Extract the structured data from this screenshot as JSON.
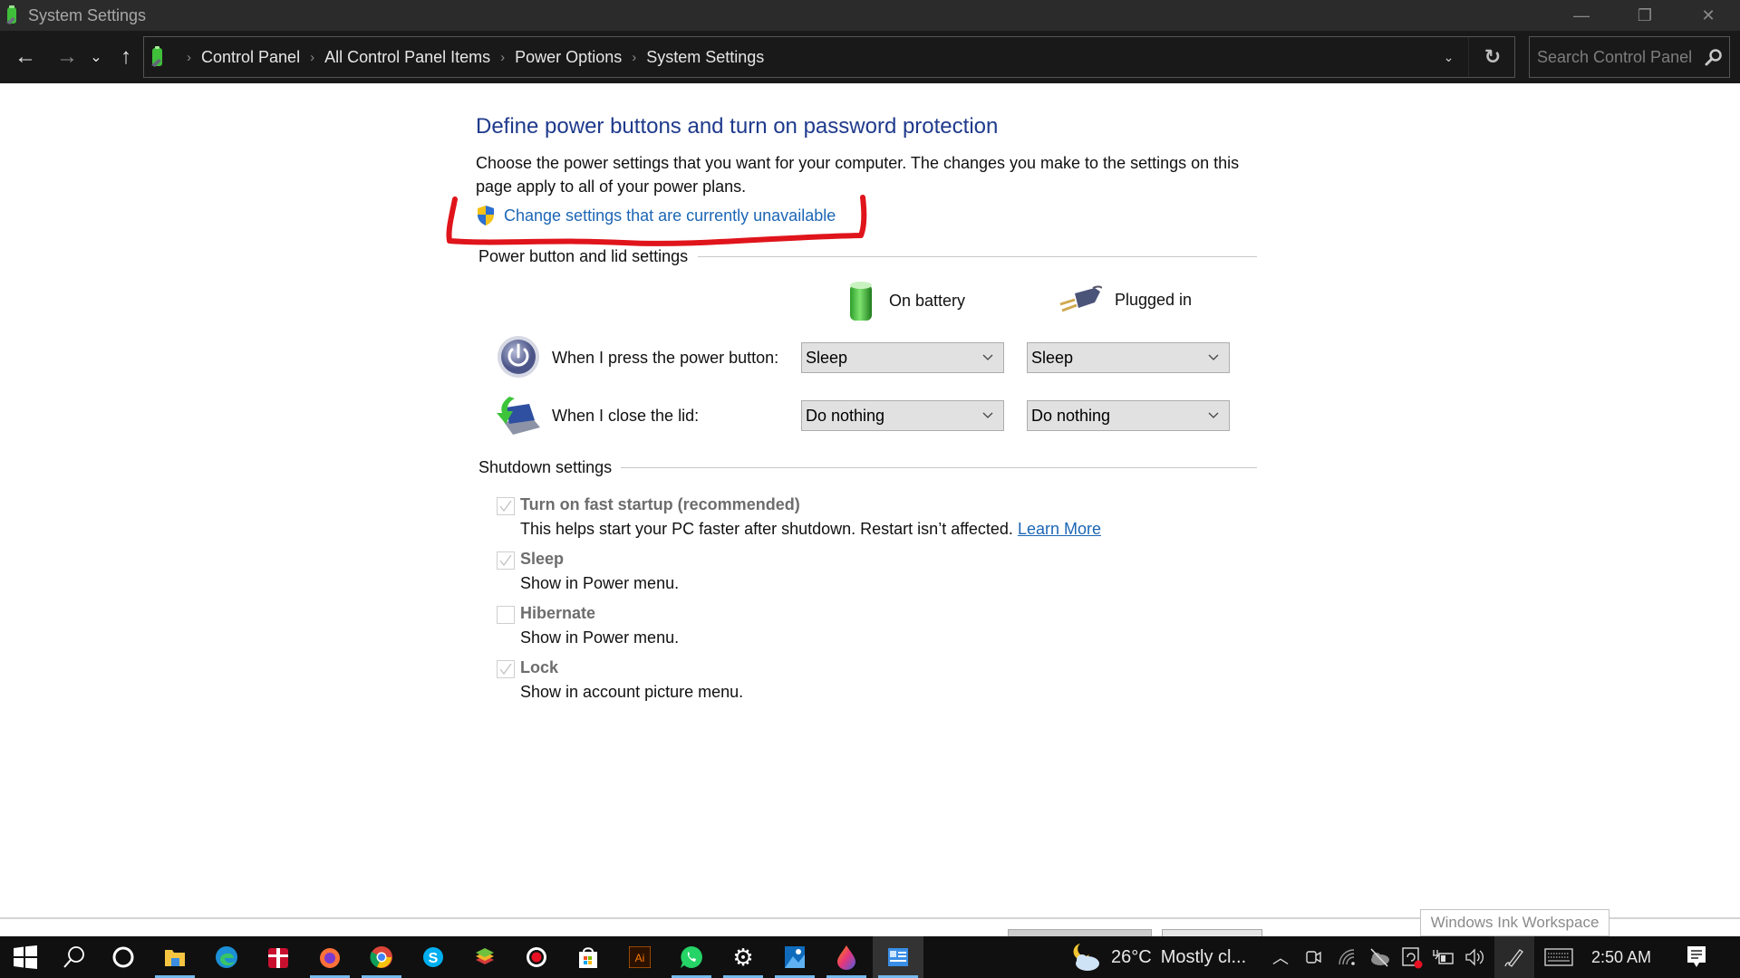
{
  "window": {
    "title": "System Settings",
    "controls": {
      "minimize": "—",
      "maximize": "❐",
      "close": "✕"
    }
  },
  "nav": {
    "back": "←",
    "forward": "→",
    "recent": "⌄",
    "up": "↑",
    "breadcrumbs": [
      "Control Panel",
      "All Control Panel Items",
      "Power Options",
      "System Settings"
    ],
    "separator": "›",
    "dropdown": "⌄",
    "refresh": "↻",
    "search_placeholder": "Search Control Panel"
  },
  "page": {
    "heading": "Define power buttons and turn on password protection",
    "description": "Choose the power settings that you want for your computer. The changes you make to the settings on this page apply to all of your power plans.",
    "uac_link": "Change settings that are currently unavailable",
    "annotation_color": "#e0141b",
    "power_section": {
      "label": "Power button and lid settings",
      "columns": [
        "On battery",
        "Plugged in"
      ],
      "rows": [
        {
          "label": "When I press the power button:",
          "icon": "power-button-icon",
          "on_battery": "Sleep",
          "plugged_in": "Sleep"
        },
        {
          "label": "When I close the lid:",
          "icon": "laptop-lid-icon",
          "on_battery": "Do nothing",
          "plugged_in": "Do nothing"
        }
      ]
    },
    "shutdown_section": {
      "label": "Shutdown settings",
      "items": [
        {
          "title": "Turn on fast startup (recommended)",
          "checked": true,
          "description": "This helps start your PC faster after shutdown. Restart isn’t affected.",
          "link": "Learn More"
        },
        {
          "title": "Sleep",
          "checked": true,
          "description": "Show in Power menu."
        },
        {
          "title": "Hibernate",
          "checked": false,
          "description": "Show in Power menu."
        },
        {
          "title": "Lock",
          "checked": true,
          "description": "Show in account picture menu."
        }
      ]
    }
  },
  "tooltip": "Windows Ink Workspace",
  "taskbar": {
    "apps": [
      {
        "name": "start",
        "running": false
      },
      {
        "name": "search",
        "running": false
      },
      {
        "name": "cortana",
        "running": false
      },
      {
        "name": "file-explorer",
        "running": true
      },
      {
        "name": "edge",
        "running": false
      },
      {
        "name": "gift-app",
        "running": false
      },
      {
        "name": "firefox",
        "running": true
      },
      {
        "name": "chrome",
        "running": true
      },
      {
        "name": "skype",
        "running": false
      },
      {
        "name": "bluestacks",
        "running": false
      },
      {
        "name": "screen-recorder",
        "running": false
      },
      {
        "name": "microsoft-store",
        "running": false
      },
      {
        "name": "adobe-illustrator",
        "running": false
      },
      {
        "name": "whatsapp",
        "running": true
      },
      {
        "name": "settings",
        "running": true
      },
      {
        "name": "photos",
        "running": true
      },
      {
        "name": "paint-3d",
        "running": true
      },
      {
        "name": "control-panel",
        "running": true
      }
    ],
    "weather": {
      "temp": "26°C",
      "condition": "Mostly cl..."
    },
    "clock": "2:50 AM",
    "illustrator_label": "Ai"
  }
}
